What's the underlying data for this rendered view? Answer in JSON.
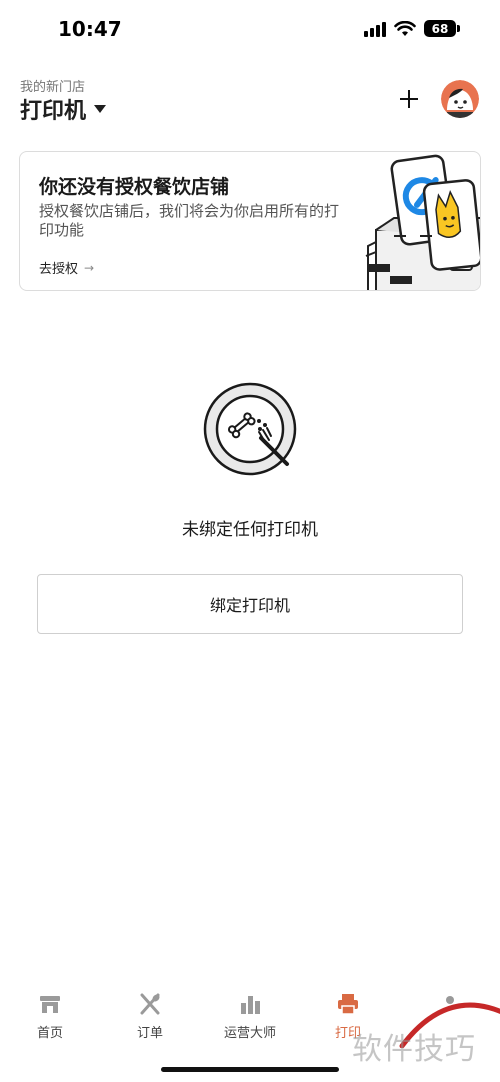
{
  "status_bar": {
    "time": "10:47",
    "battery": "68"
  },
  "header": {
    "store_name": "我的新门店",
    "title": "打印机",
    "add_icon": "plus-icon",
    "avatar_icon": "avatar"
  },
  "auth_card": {
    "title": "你还没有授权餐饮店铺",
    "description": "授权餐饮店铺后，我们将会为你启用所有的打印功能",
    "link_label": "去授权",
    "link_arrow": "→"
  },
  "empty_state": {
    "message": "未绑定任何打印机",
    "icon": "plate-icon"
  },
  "bind_button": {
    "label": "绑定打印机"
  },
  "tabbar": {
    "tabs": [
      {
        "label": "首页",
        "icon": "store-icon",
        "active": false
      },
      {
        "label": "订单",
        "icon": "utensils-icon",
        "active": false
      },
      {
        "label": "运营大师",
        "icon": "bar-chart-icon",
        "active": false
      },
      {
        "label": "打印",
        "icon": "printer-icon",
        "active": true
      }
    ]
  },
  "watermark": "软件技巧",
  "colors": {
    "accent": "#d96a43",
    "text": "#1a1a1a",
    "border": "#dcdcdc"
  }
}
